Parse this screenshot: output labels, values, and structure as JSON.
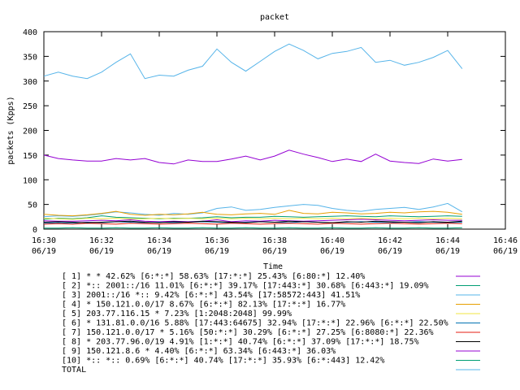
{
  "chart_data": {
    "type": "line",
    "title": "packet",
    "xlabel": "Time",
    "ylabel": "packets (Kpps)",
    "ylim": [
      0,
      400
    ],
    "yticks": [
      0,
      50,
      100,
      150,
      200,
      250,
      300,
      350,
      400
    ],
    "xlim": [
      "16:30",
      "16:46"
    ],
    "xticks": [
      {
        "time": "16:30",
        "date": "06/19"
      },
      {
        "time": "16:32",
        "date": "06/19"
      },
      {
        "time": "16:34",
        "date": "06/19"
      },
      {
        "time": "16:36",
        "date": "06/19"
      },
      {
        "time": "16:38",
        "date": "06/19"
      },
      {
        "time": "16:40",
        "date": "06/19"
      },
      {
        "time": "16:42",
        "date": "06/19"
      },
      {
        "time": "16:44",
        "date": "06/19"
      },
      {
        "time": "16:46",
        "date": "06/19"
      }
    ],
    "x": [
      "16:30:00",
      "16:30:30",
      "16:31:00",
      "16:31:30",
      "16:32:00",
      "16:32:30",
      "16:33:00",
      "16:33:30",
      "16:34:00",
      "16:34:30",
      "16:35:00",
      "16:35:30",
      "16:36:00",
      "16:36:30",
      "16:37:00",
      "16:37:30",
      "16:38:00",
      "16:38:30",
      "16:39:00",
      "16:39:30",
      "16:40:00",
      "16:40:30",
      "16:41:00",
      "16:41:30",
      "16:42:00",
      "16:42:30",
      "16:43:00",
      "16:43:30",
      "16:44:00",
      "16:44:30"
    ],
    "legend_position": "bottom",
    "series": [
      {
        "name": "[ 1] * * 42.62%  [6:*:*] 58.63% [17:*:*] 25.43% [6:80:*] 12.40%",
        "color": "#9400d3",
        "values": [
          17,
          16,
          16,
          17,
          18,
          17,
          19,
          16,
          15,
          16,
          15,
          16,
          19,
          15,
          17,
          16,
          18,
          17,
          16,
          17,
          18,
          19,
          20,
          19,
          18,
          17,
          18,
          19,
          18,
          18
        ]
      },
      {
        "name": "[ 2] *:: 2001::/16 11.01%  [6:*:*] 39.17% [17:443:*] 30.68% [6:443:*] 19.09%",
        "color": "#009e73",
        "values": [
          20,
          22,
          21,
          23,
          27,
          24,
          23,
          22,
          21,
          22,
          22,
          23,
          25,
          23,
          24,
          24,
          26,
          25,
          24,
          25,
          26,
          27,
          26,
          25,
          27,
          26,
          25,
          26,
          27,
          26
        ]
      },
      {
        "name": "[ 3] 2001::/16 *:: 9.42%  [6:*:*] 43.54% [17:58572:443] 41.51%",
        "color": "#56b4e9",
        "values": [
          25,
          27,
          26,
          28,
          31,
          35,
          33,
          30,
          28,
          32,
          30,
          33,
          42,
          45,
          38,
          40,
          44,
          47,
          50,
          48,
          42,
          38,
          36,
          40,
          42,
          44,
          40,
          45,
          52,
          35
        ]
      },
      {
        "name": "[ 4] * 150.121.0.0/17 8.67%  [6:*:*] 82.13% [17:*:*] 16.77%",
        "color": "#e69f00",
        "values": [
          30,
          28,
          27,
          29,
          32,
          36,
          30,
          28,
          30,
          29,
          31,
          34,
          30,
          29,
          31,
          32,
          30,
          38,
          32,
          31,
          34,
          33,
          31,
          32,
          34,
          33,
          35,
          36,
          34,
          30
        ]
      },
      {
        "name": "[ 5] 203.77.116.15 * 7.23%  [1:2048:2048] 99.99%",
        "color": "#f0e442",
        "values": [
          22,
          21,
          20,
          22,
          21,
          22,
          21,
          21,
          22,
          21,
          22,
          21,
          22,
          21,
          22,
          21,
          22,
          21,
          22,
          21,
          22,
          21,
          22,
          21,
          22,
          21,
          22,
          21,
          22,
          21
        ]
      },
      {
        "name": "[ 6] * 131.81.0.0/16 5.88%  [17:443:64675] 32.94% [17:*:*] 22.96% [6:*:*] 22.50%",
        "color": "#0072b2",
        "values": [
          12,
          13,
          12,
          14,
          13,
          15,
          14,
          13,
          14,
          13,
          14,
          15,
          14,
          13,
          14,
          15,
          14,
          13,
          15,
          14,
          13,
          14,
          15,
          14,
          13,
          14,
          15,
          14,
          13,
          14
        ]
      },
      {
        "name": "[ 7] 150.121.0.0/17 * 5.16%  [50:*:*] 30.29% [6:*:*] 27.25% [6:8080:*] 22.36%",
        "color": "#e51e10",
        "values": [
          10,
          11,
          10,
          12,
          11,
          10,
          12,
          11,
          10,
          11,
          12,
          11,
          10,
          12,
          11,
          10,
          11,
          12,
          11,
          10,
          12,
          11,
          10,
          11,
          12,
          11,
          10,
          11,
          12,
          11
        ]
      },
      {
        "name": "[ 8] * 203.77.96.0/19 4.91%  [1:*:*] 40.74% [6:*:*] 37.09% [17:*:*] 18.75%",
        "color": "#000000",
        "values": [
          14,
          15,
          14,
          13,
          14,
          15,
          16,
          14,
          13,
          15,
          14,
          16,
          15,
          14,
          13,
          15,
          14,
          16,
          15,
          14,
          13,
          15,
          14,
          16,
          15,
          14,
          13,
          15,
          14,
          16
        ]
      },
      {
        "name": "[ 9] 150.121.8.6 * 4.40%  [6:*:*] 63.34% [6:443:*] 36.03%",
        "color": "#9400d3",
        "values": [
          150,
          143,
          140,
          138,
          138,
          143,
          140,
          143,
          135,
          132,
          140,
          137,
          137,
          142,
          148,
          140,
          148,
          160,
          152,
          145,
          137,
          142,
          137,
          152,
          138,
          135,
          133,
          142,
          138,
          141
        ]
      },
      {
        "name": "[10] *:: *:: 0.69%  [6:*:*] 40.74% [17:*:*] 35.93% [6:*:443] 12.42%",
        "color": "#009e73",
        "values": [
          2,
          2,
          3,
          2,
          2,
          3,
          2,
          2,
          3,
          2,
          2,
          3,
          2,
          2,
          3,
          2,
          2,
          3,
          2,
          2,
          3,
          2,
          2,
          3,
          2,
          2,
          3,
          2,
          2,
          3
        ]
      },
      {
        "name": "TOTAL",
        "color": "#56b4e9",
        "values": [
          310,
          318,
          310,
          305,
          318,
          338,
          355,
          305,
          312,
          310,
          322,
          330,
          365,
          338,
          320,
          340,
          360,
          375,
          362,
          345,
          356,
          360,
          368,
          338,
          342,
          332,
          338,
          348,
          362,
          325
        ]
      }
    ]
  }
}
